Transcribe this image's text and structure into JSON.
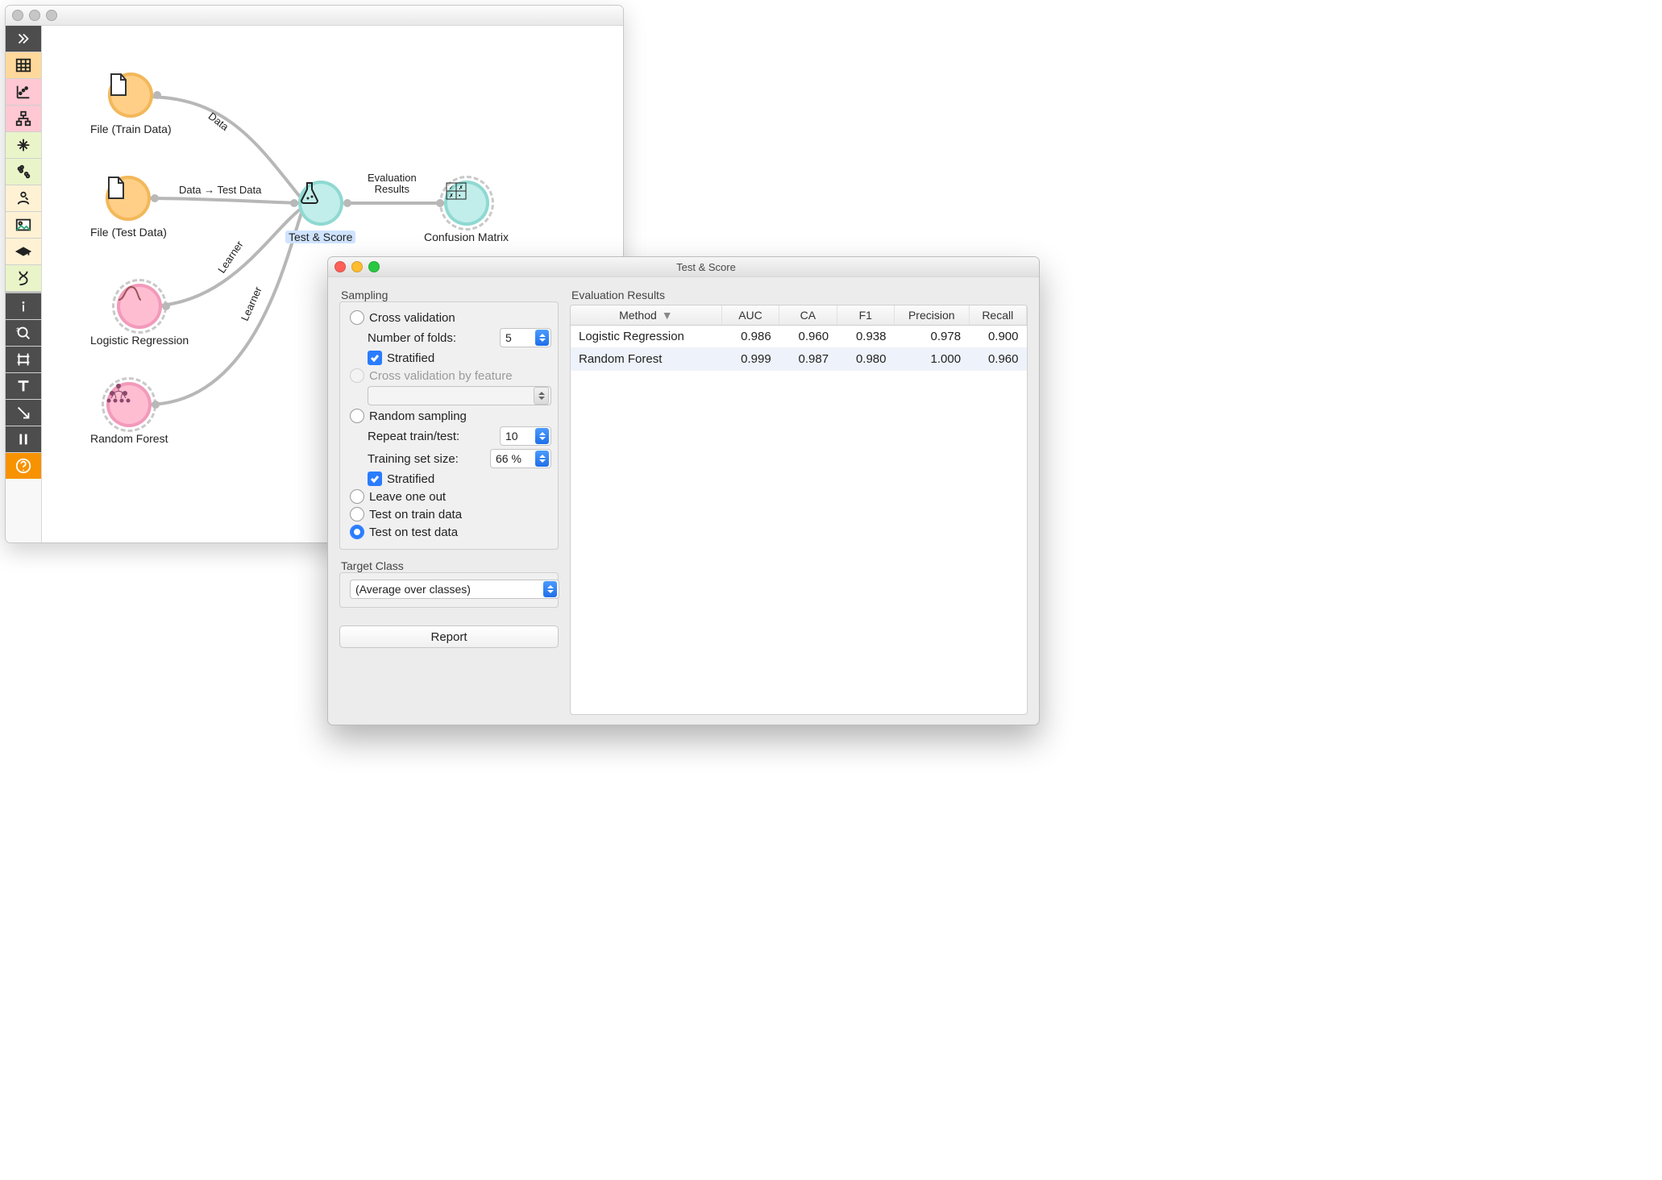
{
  "canvas": {
    "toolbar": [
      {
        "name": "expand-icon",
        "bg": "bg-dgrey"
      },
      {
        "name": "table-icon",
        "bg": "bg-orange"
      },
      {
        "name": "scatter-icon",
        "bg": "bg-pink"
      },
      {
        "name": "hierarchy-icon",
        "bg": "bg-pink"
      },
      {
        "name": "grid-icon",
        "bg": "bg-lgreen"
      },
      {
        "name": "cluster-icon",
        "bg": "bg-lgreen"
      },
      {
        "name": "worker-icon",
        "bg": "bg-lorange"
      },
      {
        "name": "image-icon",
        "bg": "bg-lorange"
      },
      {
        "name": "hat-icon",
        "bg": "bg-lorange"
      },
      {
        "name": "dna-icon",
        "bg": "bg-lgreen"
      },
      {
        "name": "sep",
        "bg": "sep"
      },
      {
        "name": "info-icon",
        "bg": "bg-dgrey"
      },
      {
        "name": "zoom-icon",
        "bg": "bg-dgrey"
      },
      {
        "name": "hash-icon",
        "bg": "bg-dgrey"
      },
      {
        "name": "text-icon",
        "bg": "bg-dgrey"
      },
      {
        "name": "arrow-icon",
        "bg": "bg-dgrey"
      },
      {
        "name": "pause-icon",
        "bg": "bg-dgrey"
      },
      {
        "name": "help-icon",
        "bg": "bg-help"
      }
    ],
    "widgets": {
      "file_train": "File (Train Data)",
      "file_test": "File (Test Data)",
      "logreg": "Logistic Regression",
      "rf": "Random Forest",
      "test_score": "Test & Score",
      "confusion": "Confusion Matrix"
    },
    "edges": {
      "data": "Data",
      "data_testdata": "Data → Test Data",
      "learner": "Learner",
      "eval_results": "Evaluation Results"
    }
  },
  "dialog": {
    "title": "Test & Score",
    "sampling": {
      "label": "Sampling",
      "cross_validation": "Cross validation",
      "number_of_folds_label": "Number of folds:",
      "number_of_folds_value": "5",
      "stratified": "Stratified",
      "cv_by_feature": "Cross validation by feature",
      "random_sampling": "Random sampling",
      "repeat_label": "Repeat train/test:",
      "repeat_value": "10",
      "training_size_label": "Training set size:",
      "training_size_value": "66 %",
      "leave_one_out": "Leave one out",
      "test_on_train": "Test on train data",
      "test_on_test": "Test on test data"
    },
    "target_class": {
      "label": "Target Class",
      "value": "(Average over classes)"
    },
    "report_button": "Report",
    "results": {
      "label": "Evaluation Results",
      "columns": [
        "Method",
        "AUC",
        "CA",
        "F1",
        "Precision",
        "Recall"
      ],
      "rows": [
        {
          "method": "Logistic Regression",
          "auc": "0.986",
          "ca": "0.960",
          "f1": "0.938",
          "prec": "0.978",
          "rec": "0.900"
        },
        {
          "method": "Random Forest",
          "auc": "0.999",
          "ca": "0.987",
          "f1": "0.980",
          "prec": "1.000",
          "rec": "0.960"
        }
      ]
    }
  }
}
